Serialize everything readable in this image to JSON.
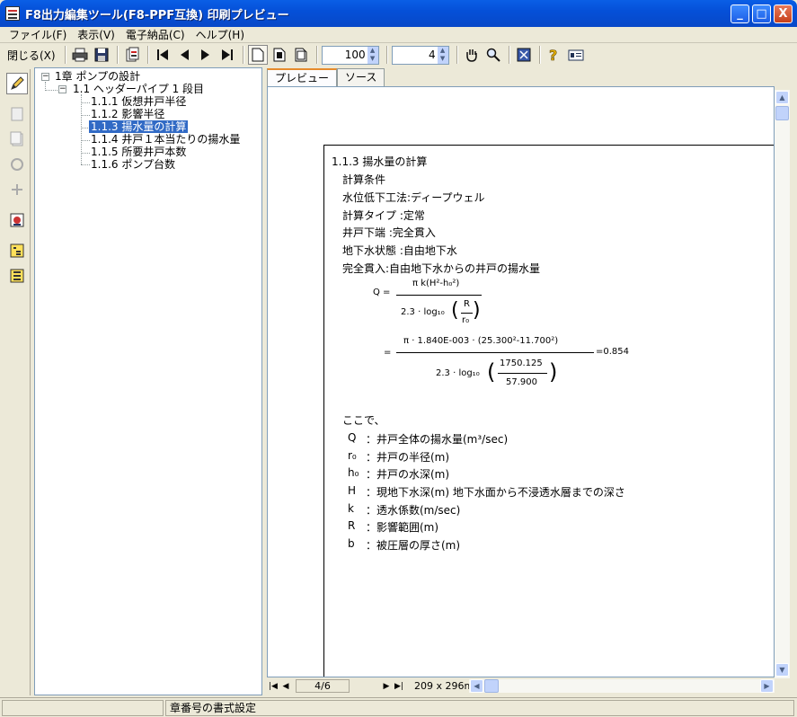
{
  "window": {
    "title": "F8出力編集ツール(F8-PPF互換) 印刷プレビュー",
    "minimize": "_",
    "maximize": "□",
    "close": "X"
  },
  "menu": [
    "ファイル(F)",
    "表示(V)",
    "電子納品(C)",
    "ヘルプ(H)"
  ],
  "toolbar": {
    "close_label": "閉じる(X)",
    "zoom_value": "100",
    "page_value": "4"
  },
  "tree": {
    "root": "1章 ポンプの設計",
    "child": "1.1 ヘッダーパイプ 1 段目",
    "items": [
      "1.1.1 仮想井戸半径",
      "1.1.2 影響半径",
      "1.1.3 揚水量の計算",
      "1.1.4 井戸１本当たりの揚水量",
      "1.1.5 所要井戸本数",
      "1.1.6 ポンプ台数"
    ],
    "selected_index": 2
  },
  "tabs": [
    "プレビュー",
    "ソース"
  ],
  "document": {
    "heading": "1.1.3 揚水量の計算",
    "lines": [
      "計算条件",
      "水位低下工法:ディープウェル",
      "計算タイプ  :定常",
      "井戸下端    :完全貫入",
      "地下水状態  :自由地下水",
      "完全貫入:自由地下水からの井戸の揚水量"
    ],
    "formula": {
      "q": "Q =",
      "num1": "π k(H²-h₀²)",
      "den1": "2.3 · log₁₀",
      "frac_r_num": "R",
      "frac_r_den": "r₀",
      "eq2": "=",
      "num2": "π · 1.840E-003 · (25.300²-11.700²)",
      "den2": "2.3 · log₁₀",
      "frac2_num": "1750.125",
      "frac2_den": "57.900",
      "result": "=0.854"
    },
    "where": "ここで、",
    "defs": [
      {
        "sym": "Q",
        "desc": "：井戸全体の揚水量(m³/sec)"
      },
      {
        "sym": "r₀",
        "desc": "：井戸の半径(m)"
      },
      {
        "sym": "h₀",
        "desc": "：井戸の水深(m)"
      },
      {
        "sym": "H",
        "desc": "：現地下水深(m) 地下水面から不浸透水層までの深さ"
      },
      {
        "sym": "k",
        "desc": "：透水係数(m/sec)"
      },
      {
        "sym": "R",
        "desc": "：影響範囲(m)"
      },
      {
        "sym": "b",
        "desc": "：被圧層の厚さ(m)"
      }
    ]
  },
  "pager": {
    "page": "4/6",
    "size": "209 x 296mm"
  },
  "status": {
    "text": "章番号の書式設定"
  }
}
